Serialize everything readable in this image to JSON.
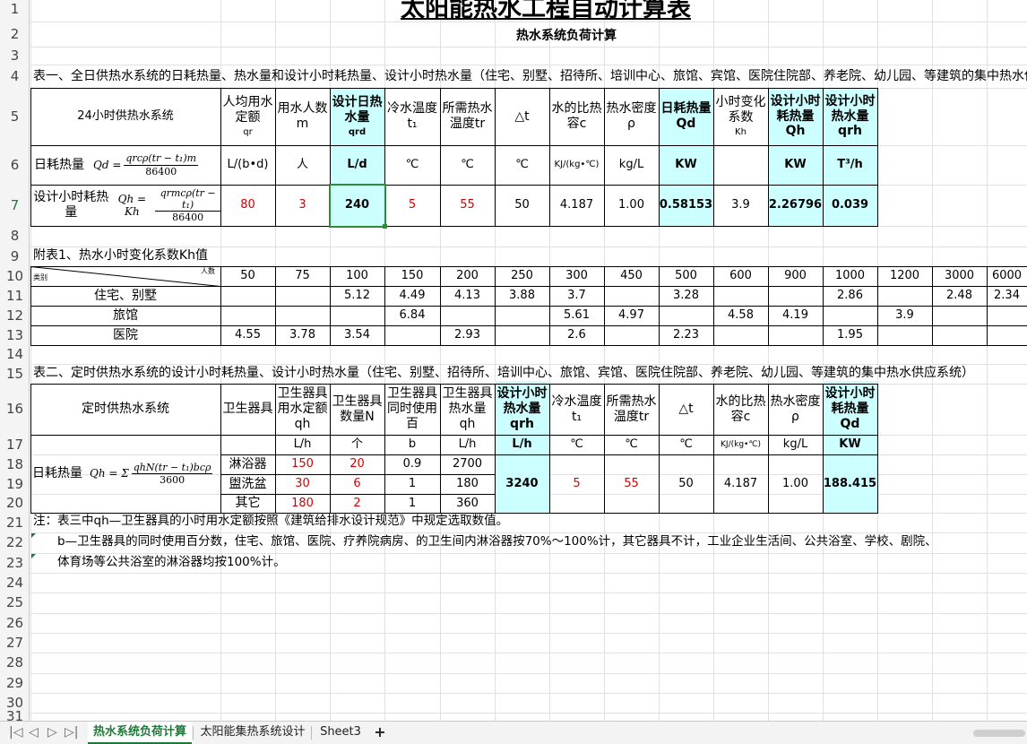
{
  "title": "太阳能热水工程自动计算表",
  "subtitle": "热水系统负荷计算",
  "row_numbers": [
    "1",
    "2",
    "3",
    "4",
    "5",
    "6",
    "7",
    "8",
    "9",
    "10",
    "11",
    "12",
    "13",
    "14",
    "15",
    "16",
    "17",
    "18",
    "19",
    "20",
    "21",
    "22",
    "23",
    "24",
    "25",
    "26",
    "27",
    "28",
    "29",
    "30",
    "31"
  ],
  "table1": {
    "caption": "表一、全日供热水系统的日耗热量、热水量和设计小时耗热量、设计小时热水量（住宅、别墅、招待所、培训中心、旅馆、宾馆、医院住院部、养老院、幼儿园、等建筑的集中热水供",
    "system_label": "24小时供热水系统",
    "headers": [
      {
        "l1": "人均用水定额",
        "sub": "qr"
      },
      {
        "l1": "用水人数m",
        "sub": ""
      },
      {
        "l1": "设计日热水量",
        "sub": "qrd"
      },
      {
        "l1": "冷水温度t₁",
        "sub": ""
      },
      {
        "l1": "所需热水温度tr",
        "sub": ""
      },
      {
        "l1": "△t",
        "sub": ""
      },
      {
        "l1": "水的比热容c",
        "sub": ""
      },
      {
        "l1": "热水密度ρ",
        "sub": ""
      },
      {
        "l1": "日耗热量Qd",
        "sub": ""
      },
      {
        "l1": "小时变化系数",
        "sub": "Kh"
      },
      {
        "l1": "设计小时耗热量 Qh",
        "sub": ""
      },
      {
        "l1": "设计小时热水量 qrh",
        "sub": ""
      }
    ],
    "daily_label": "日耗热量",
    "units": [
      "L/(b•d)",
      "人",
      "L/d",
      "℃",
      "℃",
      "℃",
      "KJ/(kg•℃)",
      "kg/L",
      "KW",
      "",
      "KW",
      "T³/h"
    ],
    "hourly_label": "设计小时耗热量",
    "values": [
      "80",
      "3",
      "240",
      "5",
      "55",
      "50",
      "4.187",
      "1.00",
      "0.58153",
      "3.9",
      "2.26796",
      "0.039"
    ],
    "formula_daily": {
      "lhs": "Qd =",
      "num": "qrcρ(tr − t₁)m",
      "den": "86400"
    },
    "formula_hourly": {
      "lhs": "Qh = Kh",
      "num": "qrmcρ(tr − t₁)",
      "den": "86400"
    }
  },
  "appendix": {
    "caption": "附表1、热水小时变化系数Kh值",
    "corner_left": "类别",
    "corner_right": "人数",
    "columns": [
      "50",
      "75",
      "100",
      "150",
      "200",
      "250",
      "300",
      "450",
      "500",
      "600",
      "900",
      "1000",
      "1200",
      "3000",
      "6000"
    ],
    "rows": [
      {
        "label": "住宅、别墅",
        "values": [
          "",
          "",
          "5.12",
          "4.49",
          "4.13",
          "3.88",
          "3.7",
          "",
          "3.28",
          "",
          "",
          "2.86",
          "",
          "2.48",
          "2.34"
        ]
      },
      {
        "label": "旅馆",
        "values": [
          "",
          "",
          "",
          "6.84",
          "",
          "",
          "5.61",
          "4.97",
          "",
          "4.58",
          "4.19",
          "",
          "3.9",
          "",
          ""
        ]
      },
      {
        "label": "医院",
        "values": [
          "4.55",
          "3.78",
          "3.54",
          "",
          "2.93",
          "",
          "2.6",
          "",
          "2.23",
          "",
          "",
          "1.95",
          "",
          "",
          ""
        ]
      }
    ]
  },
  "table2": {
    "caption": "表二、定时供热水系统的设计小时耗热量、设计小时热水量（住宅、别墅、招待所、培训中心、旅馆、宾馆、医院住院部、养老院、幼儿园、等建筑的集中热水供应系统）",
    "system_label": "定时供热水系统",
    "headers": [
      "卫生器具",
      "卫生器具用水定额 qh",
      "卫生器具数量N",
      "卫生器具同时使用百",
      "卫生器具热水量 qh",
      "设计小时热水量 qrh",
      "冷水温度t₁",
      "所需热水温度tr",
      "△t",
      "水的比热容c",
      "热水密度ρ",
      "设计小时耗热量Qd"
    ],
    "units": [
      "L/h",
      "个",
      "b",
      "L/h",
      "L/h",
      "℃",
      "℃",
      "℃",
      "KJ/(kg•℃)",
      "kg/L",
      "KW"
    ],
    "daily_label": "日耗热量",
    "formula": {
      "lhs": "Qh = Σ",
      "num": "qhN(tr − t₁)bcρ",
      "den": "3600"
    },
    "fixtures": [
      {
        "name": "淋浴器",
        "rate": "150",
        "count": "20",
        "pct": "0.9",
        "hot": "2700"
      },
      {
        "name": "盥洗盆",
        "rate": "30",
        "count": "6",
        "pct": "1",
        "hot": "180"
      },
      {
        "name": "其它",
        "rate": "180",
        "count": "2",
        "pct": "1",
        "hot": "360"
      }
    ],
    "merged": {
      "qrh": "3240",
      "t1": "5",
      "tr": "55",
      "dt": "50",
      "c": "4.187",
      "rho": "1.00",
      "Qd": "188.415"
    }
  },
  "notes": [
    "注：表三中qh—卫生器具的小时用水定额按照《建筑给排水设计规范》中规定选取数值。",
    "b—卫生器具的同时使用百分数，住宅、旅馆、医院、疗养院病房、的卫生间内淋浴器按70%～100%计，其它器具不计，工业企业生活间、公共浴室、学校、剧院、",
    "体育场等公共浴室的淋浴器均按100%计。"
  ],
  "sheet_tabs": [
    "热水系统负荷计算",
    "太阳能集热系统设计",
    "Sheet3"
  ],
  "add_sheet_label": "+",
  "nav_icons": [
    "first-sheet-icon",
    "prev-sheet-icon",
    "next-sheet-icon",
    "last-sheet-icon"
  ],
  "colors": {
    "highlight": "#ccffff",
    "red_value": "#d40000",
    "active_tab": "#1f7a3a",
    "selected_border": "#2e8b3a"
  }
}
